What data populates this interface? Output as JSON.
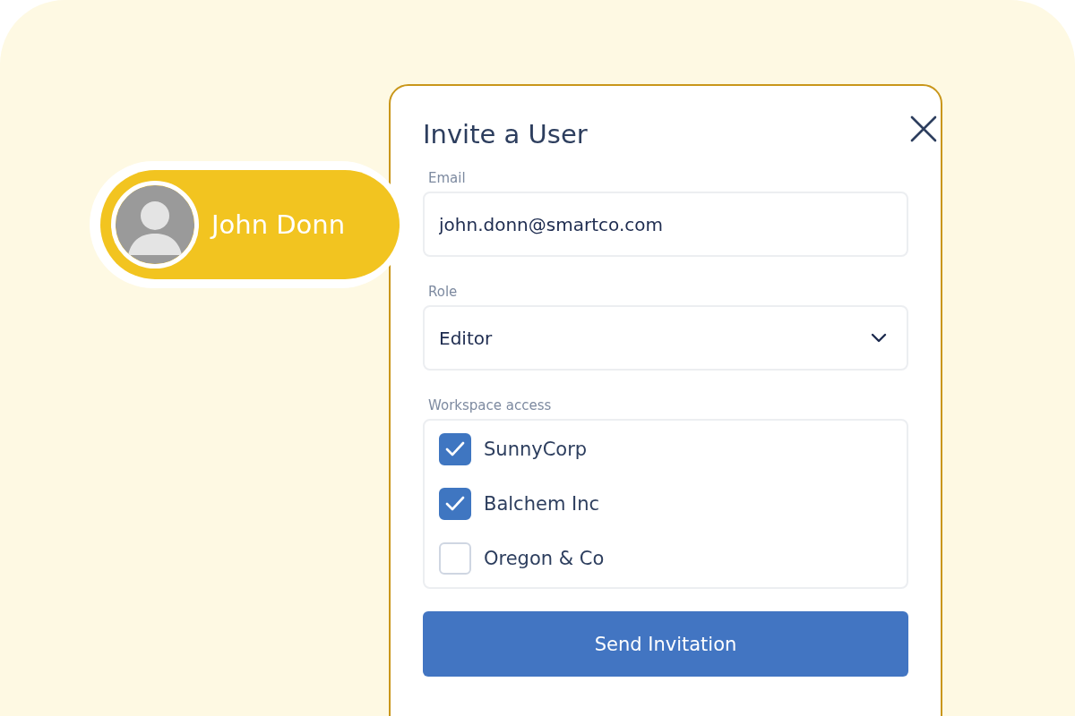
{
  "user_chip": {
    "name": "John Donn"
  },
  "dialog": {
    "title": "Invite a User",
    "email": {
      "label": "Email",
      "value": "john.donn@smartco.com"
    },
    "role": {
      "label": "Role",
      "value": "Editor"
    },
    "workspace_access": {
      "label": "Workspace access",
      "items": [
        {
          "label": "SunnyCorp",
          "checked": true
        },
        {
          "label": "Balchem Inc",
          "checked": true
        },
        {
          "label": "Oregon & Co",
          "checked": false
        }
      ]
    },
    "button": "Send Invitation"
  }
}
